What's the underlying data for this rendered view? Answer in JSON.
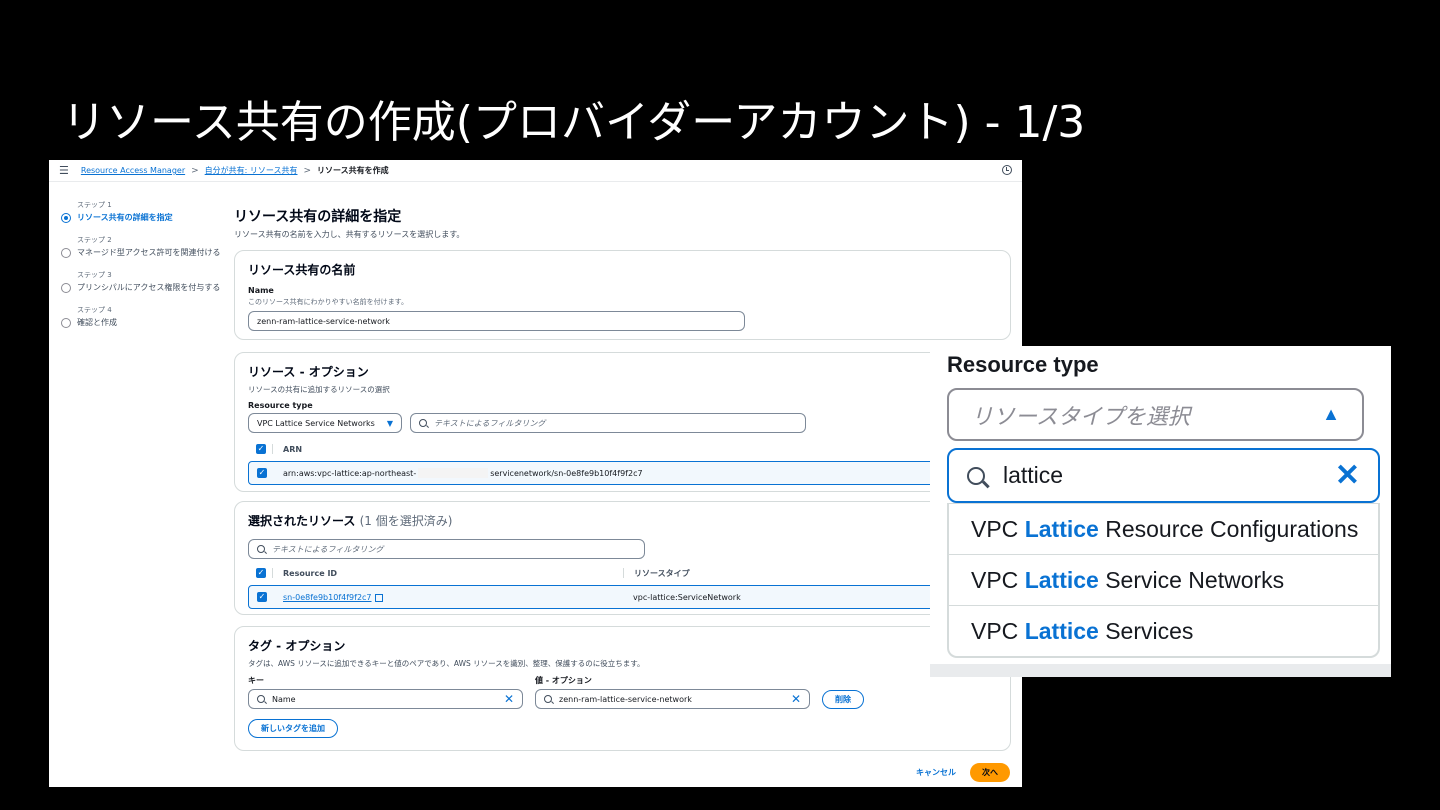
{
  "slide": {
    "title": "リソース共有の作成(プロバイダーアカウント) - 1/3"
  },
  "breadcrumb": {
    "items": [
      "Resource Access Manager",
      "自分が共有: リソース共有",
      "リソース共有を作成"
    ]
  },
  "steps": [
    {
      "num": "ステップ 1",
      "label": "リソース共有の詳細を指定",
      "active": true
    },
    {
      "num": "ステップ 2",
      "label": "マネージド型アクセス許可を関連付ける",
      "active": false
    },
    {
      "num": "ステップ 3",
      "label": "プリンシパルにアクセス権限を付与する",
      "active": false
    },
    {
      "num": "ステップ 4",
      "label": "確認と作成",
      "active": false
    }
  ],
  "page": {
    "heading": "リソース共有の詳細を指定",
    "description": "リソース共有の名前を入力し、共有するリソースを選択します。"
  },
  "name_section": {
    "title": "リソース共有の名前",
    "field_label": "Name",
    "field_desc": "このリソース共有にわかりやすい名前を付けます。",
    "value": "zenn-ram-lattice-service-network"
  },
  "resources_section": {
    "title": "リソース - オプション",
    "desc": "リソースの共有に追加するリソースの選択",
    "type_label": "Resource type",
    "type_value": "VPC Lattice Service Networks",
    "filter_placeholder": "テキストによるフィルタリング",
    "col_arn": "ARN",
    "arn_prefix": "arn:aws:vpc-lattice:ap-northeast-",
    "arn_suffix": "servicenetwork/sn-0e8fe9b10f4f9f2c7"
  },
  "selected_section": {
    "title": "選択されたリソース",
    "count": "(1 個を選択済み)",
    "filter_placeholder": "テキストによるフィルタリング",
    "col_id": "Resource ID",
    "col_type": "リソースタイプ",
    "row_id": "sn-0e8fe9b10f4f9f2c7",
    "row_type": "vpc-lattice:ServiceNetwork"
  },
  "tags_section": {
    "title": "タグ - オプション",
    "desc": "タグは、AWS リソースに追加できるキーと値のペアであり、AWS リソースを識別、整理、保護するのに役立ちます。",
    "key_label": "キー",
    "value_label": "値 - オプション",
    "key_value": "Name",
    "value_value": "zenn-ram-lattice-service-network",
    "remove_label": "削除",
    "add_label": "新しいタグを追加"
  },
  "footer": {
    "cancel": "キャンセル",
    "next": "次へ"
  },
  "zoom": {
    "label": "Resource type",
    "placeholder": "リソースタイプを選択",
    "search_value": "lattice",
    "options": [
      {
        "pre": "VPC ",
        "hl": "Lattice",
        "post": " Resource Configurations"
      },
      {
        "pre": "VPC ",
        "hl": "Lattice",
        "post": " Service Networks"
      },
      {
        "pre": "VPC ",
        "hl": "Lattice",
        "post": " Services"
      }
    ]
  }
}
